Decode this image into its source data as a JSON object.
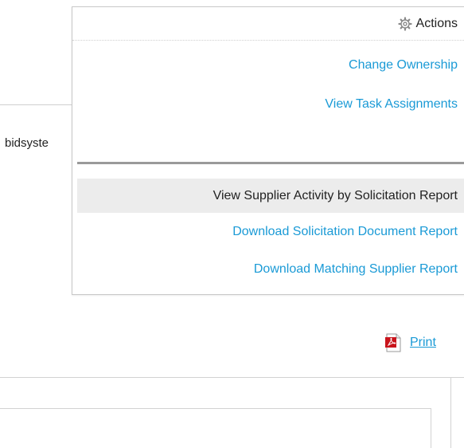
{
  "background": {
    "partial_text": "bidsyste"
  },
  "actions_menu": {
    "title": "Actions",
    "icon": "gear-icon",
    "items": [
      {
        "label": "Change Ownership"
      },
      {
        "label": "View Task Assignments"
      },
      {
        "label": "View Supplier Activity by Solicitation Report",
        "highlighted": true
      },
      {
        "label": "Download Solicitation Document Report"
      },
      {
        "label": "Download Matching Supplier Report"
      }
    ]
  },
  "print": {
    "label": "Print",
    "icon": "pdf-icon"
  },
  "colors": {
    "link": "#1a9ad6",
    "highlight_bg": "#ececec",
    "separator": "#9a9a9a"
  }
}
